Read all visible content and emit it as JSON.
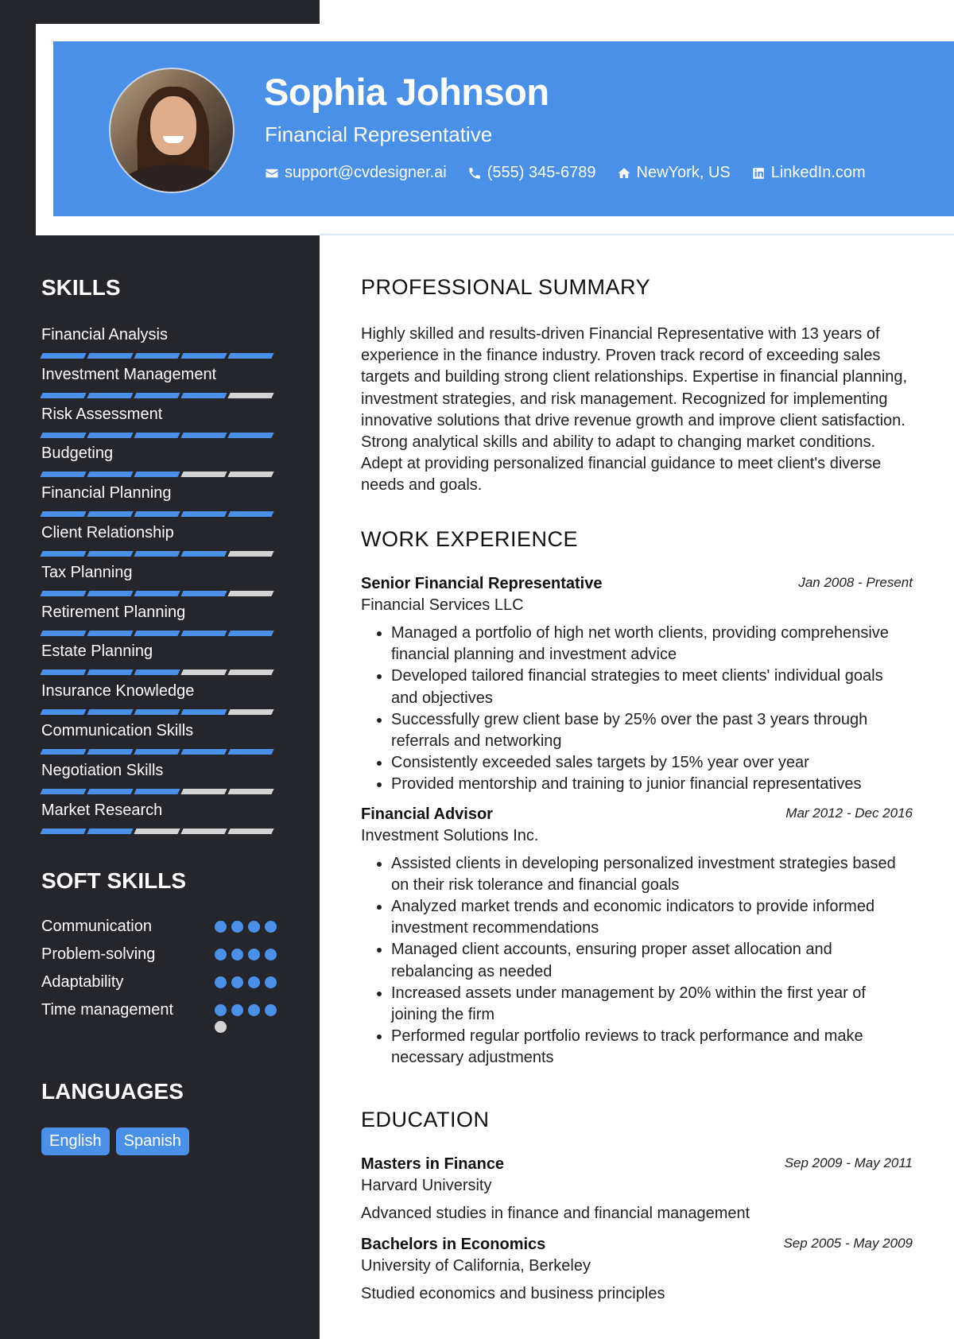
{
  "header": {
    "name": "Sophia Johnson",
    "role": "Financial Representative",
    "contacts": {
      "email": "support@cvdesigner.ai",
      "phone": "(555) 345-6789",
      "location": "NewYork, US",
      "linkedin": "LinkedIn.com"
    },
    "accent_color": "#4a90e8"
  },
  "sidebar": {
    "skills_heading": "SKILLS",
    "skills": [
      {
        "name": "Financial Analysis",
        "level": 5,
        "max": 5
      },
      {
        "name": "Investment Management",
        "level": 4,
        "max": 5
      },
      {
        "name": "Risk Assessment",
        "level": 5,
        "max": 5
      },
      {
        "name": "Budgeting",
        "level": 3,
        "max": 5
      },
      {
        "name": "Financial Planning",
        "level": 5,
        "max": 5
      },
      {
        "name": "Client Relationship",
        "level": 4,
        "max": 5
      },
      {
        "name": "Tax Planning",
        "level": 4,
        "max": 5
      },
      {
        "name": "Retirement Planning",
        "level": 5,
        "max": 5
      },
      {
        "name": "Estate Planning",
        "level": 3,
        "max": 5
      },
      {
        "name": "Insurance Knowledge",
        "level": 4,
        "max": 5
      },
      {
        "name": "Communication Skills",
        "level": 5,
        "max": 5
      },
      {
        "name": "Negotiation Skills",
        "level": 3,
        "max": 5
      },
      {
        "name": "Market Research",
        "level": 2,
        "max": 5
      }
    ],
    "soft_skills_heading": "SOFT SKILLS",
    "soft_skills": [
      {
        "name": "Communication",
        "level": 4,
        "max": 4
      },
      {
        "name": "Problem-solving",
        "level": 4,
        "max": 4
      },
      {
        "name": "Adaptability",
        "level": 4,
        "max": 4
      },
      {
        "name": "Time management",
        "level": 4,
        "max": 5
      }
    ],
    "languages_heading": "LANGUAGES",
    "languages": [
      "English",
      "Spanish"
    ]
  },
  "main": {
    "summary_heading": "PROFESSIONAL SUMMARY",
    "summary": "Highly skilled and results-driven Financial Representative with 13 years of experience in the finance industry. Proven track record of exceeding sales targets and building strong client relationships. Expertise in financial planning, investment strategies, and risk management. Recognized for implementing innovative solutions that drive revenue growth and improve client satisfaction. Strong analytical skills and ability to adapt to changing market conditions. Adept at providing personalized financial guidance to meet client's diverse needs and goals.",
    "experience_heading": "WORK EXPERIENCE",
    "jobs": [
      {
        "title": "Senior Financial Representative",
        "org": "Financial Services LLC",
        "date": "Jan 2008 - Present",
        "bullets": [
          "Managed a portfolio of high net worth clients, providing comprehensive financial planning and investment advice",
          "Developed tailored financial strategies to meet clients' individual goals and objectives",
          "Successfully grew client base by 25% over the past 3 years through referrals and networking",
          "Consistently exceeded sales targets by 15% year over year",
          "Provided mentorship and training to junior financial representatives"
        ]
      },
      {
        "title": "Financial Advisor",
        "org": "Investment Solutions Inc.",
        "date": "Mar 2012 - Dec 2016",
        "bullets": [
          "Assisted clients in developing personalized investment strategies based on their risk tolerance and financial goals",
          "Analyzed market trends and economic indicators to provide informed investment recommendations",
          "Managed client accounts, ensuring proper asset allocation and rebalancing as needed",
          "Increased assets under management by 20% within the first year of joining the firm",
          "Performed regular portfolio reviews to track performance and make necessary adjustments"
        ]
      }
    ],
    "education_heading": "EDUCATION",
    "education": [
      {
        "degree": "Masters in Finance",
        "school": "Harvard University",
        "date": "Sep 2009 - May 2011",
        "desc": "Advanced studies in finance and financial management"
      },
      {
        "degree": "Bachelors in Economics",
        "school": "University of California, Berkeley",
        "date": "Sep 2005 - May 2009",
        "desc": "Studied economics and business principles"
      }
    ]
  }
}
